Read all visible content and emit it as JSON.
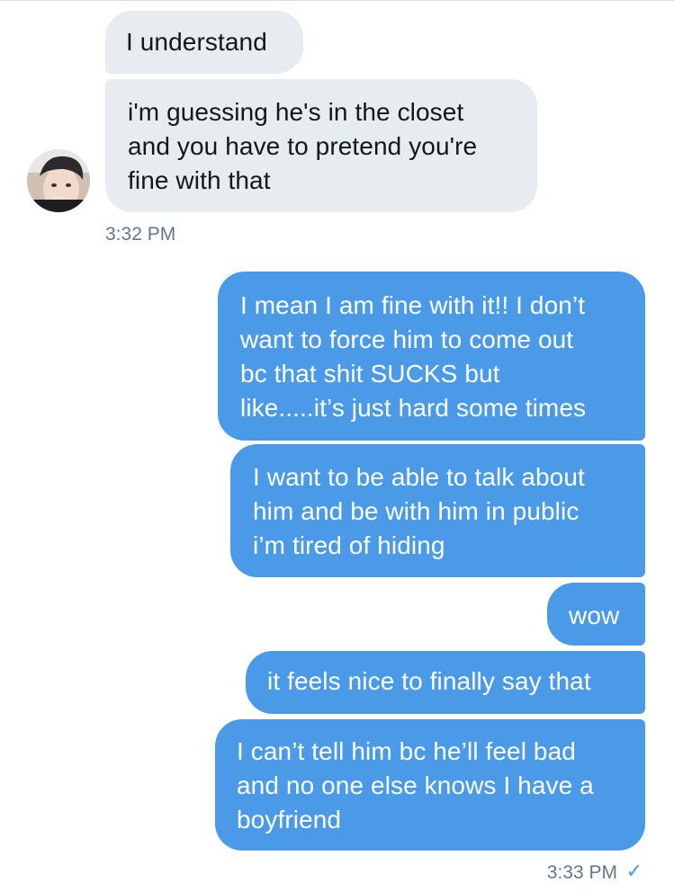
{
  "conversation": {
    "incoming": [
      {
        "text": "I understand"
      },
      {
        "text": "i'm guessing he's in the closet\nand you have to pretend you're\nfine with that"
      }
    ],
    "incoming_time": "3:32 PM",
    "outgoing": [
      {
        "text": "I mean I am fine with it!! I don’t\nwant to force him to come out\nbc that shit SUCKS but\nlike.....it’s just hard some times"
      },
      {
        "text": "I want to be able to talk about\nhim and be with him in public\ni’m tired of hiding"
      },
      {
        "text": "wow"
      },
      {
        "text": "it feels nice to finally say that"
      },
      {
        "text": "I can’t tell him bc he’ll feel bad\nand no one else knows I have a\nboyfriend"
      }
    ],
    "outgoing_time": "3:33 PM",
    "read_receipt_icon": "checkmark-icon"
  },
  "colors": {
    "incoming_bubble": "#e6ecf0",
    "outgoing_bubble": "#4a9ae8",
    "timestamp": "#657786"
  }
}
